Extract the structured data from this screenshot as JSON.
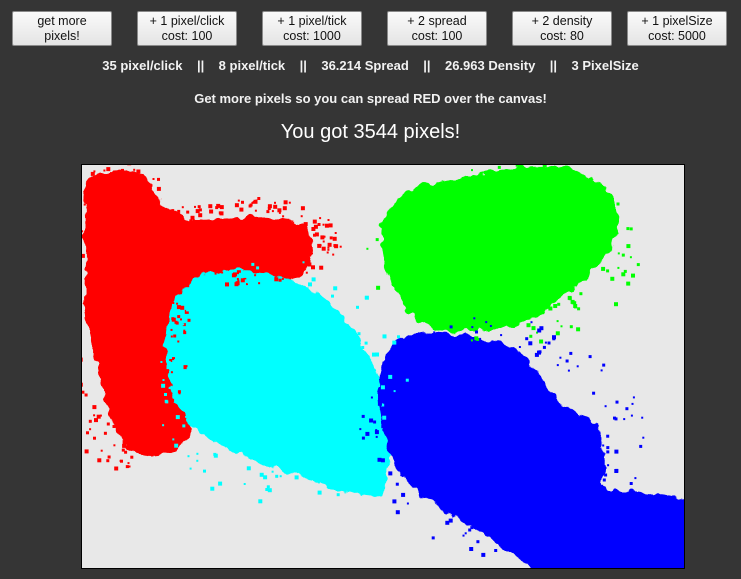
{
  "buttons": [
    {
      "line1": "get more",
      "line2": "pixels!"
    },
    {
      "line1": "+ 1 pixel/click",
      "line2": "cost: 100"
    },
    {
      "line1": "+ 1 pixel/tick",
      "line2": "cost: 1000"
    },
    {
      "line1": "+ 2 spread",
      "line2": "cost: 100"
    },
    {
      "line1": "+ 2 density",
      "line2": "cost: 80"
    },
    {
      "line1": "+ 1 pixelSize",
      "line2": "cost: 5000"
    }
  ],
  "stats": {
    "per_click": "35 pixel/click",
    "per_tick": "8 pixel/tick",
    "spread": "36.214 Spread",
    "density": "26.963 Density",
    "pixel_size": "3 PixelSize",
    "separator": "||"
  },
  "subtitle": "Get more pixels so you can spread RED over the canvas!",
  "headline": "You got 3544 pixels!",
  "colors": {
    "background": "#353535",
    "canvas": "#e8e8e8",
    "red": "#ff0000",
    "cyan": "#00ffff",
    "green": "#00ff00",
    "blue": "#0000ff"
  }
}
